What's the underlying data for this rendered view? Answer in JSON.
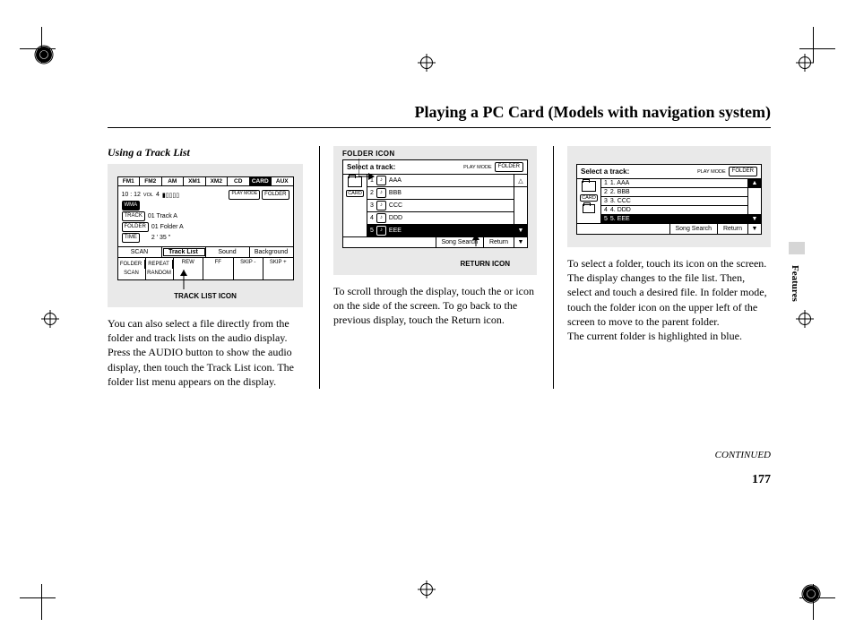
{
  "page": {
    "title": "Playing a PC Card (Models with navigation system)",
    "continued": "CONTINUED",
    "number": "177",
    "side_tab": "Features"
  },
  "col1": {
    "subhead": "Using a Track List",
    "caption": "TRACK LIST ICON",
    "screen": {
      "tabs": [
        "FM1",
        "FM2",
        "AM",
        "XM1",
        "XM2",
        "CD",
        "CARD",
        "AUX"
      ],
      "selected_tab": 6,
      "time": "10 : 12",
      "vol_label": "VOL",
      "vol_value": "4",
      "play_mode_btn": "PLAY MODE",
      "folder_btn": "FOLDER",
      "wma_badge": "WMA",
      "track_badge": "TRACK",
      "track_line": "01  Track  A",
      "folder_badge": "FOLDER",
      "folder_line": "01  Folder  A",
      "time_badge": "TIME",
      "time_line": "2 ' 35 \"",
      "actions": {
        "scan": "SCAN",
        "tracklist": "Track  List",
        "sound": "Sound",
        "background": "Background"
      },
      "bottom": [
        "FOLDER",
        "RANDOM",
        "REPEAT",
        "REW",
        "FF",
        "SKIP -",
        "SKIP +"
      ],
      "bottom_left_top": "FOLDER",
      "bottom_left_bottom": "SCAN"
    },
    "body": "You can also select a file directly from the folder and track lists on the audio display. Press the AUDIO button to show the audio display, then touch the Track List icon. The folder list menu appears on the display."
  },
  "col2": {
    "top_label": "FOLDER ICON",
    "caption": "RETURN ICON",
    "screen": {
      "heading": "Select a track:",
      "play_mode_btn": "PLAY MODE",
      "folder_btn": "FOLDER",
      "card_label": "CARD",
      "rows": [
        {
          "n": "1",
          "type": "track",
          "name": "AAA"
        },
        {
          "n": "2",
          "type": "track",
          "name": "BBB"
        },
        {
          "n": "3",
          "type": "track",
          "name": "CCC"
        },
        {
          "n": "4",
          "type": "track",
          "name": "DDD"
        },
        {
          "n": "5",
          "type": "track",
          "name": "EEE"
        }
      ],
      "highlight_row": 4,
      "song_search": "Song Search",
      "return_btn": "Return"
    },
    "body": "To scroll through the display, touch the      or      icon on the side of the screen. To go back to the previous display, touch the Return icon."
  },
  "col3": {
    "screen": {
      "heading": "Select a track:",
      "play_mode_btn": "PLAY MODE",
      "folder_btn": "FOLDER",
      "card_label": "CARD",
      "rows": [
        {
          "n": "1",
          "name": "1. AAA"
        },
        {
          "n": "2",
          "name": "2. BBB"
        },
        {
          "n": "3",
          "name": "3. CCC"
        },
        {
          "n": "4",
          "name": "4. DDD"
        },
        {
          "n": "5",
          "name": "5. EEE"
        }
      ],
      "highlight_row": 4,
      "song_search": "Song Search",
      "return_btn": "Return"
    },
    "body": "To select a folder, touch its icon on the screen. The display changes to the file list. Then, select and touch a desired file. In folder mode, touch the folder icon on the upper left of the screen to move to the parent folder.",
    "body2": "The current folder is highlighted in blue."
  }
}
